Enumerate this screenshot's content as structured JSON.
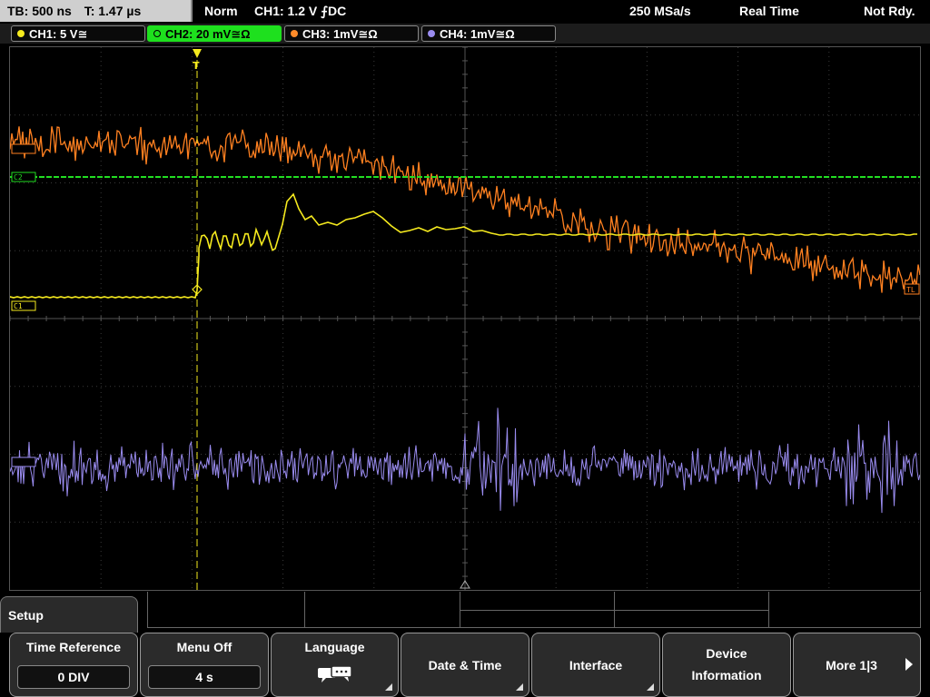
{
  "status": {
    "timebase": "TB: 500 ns",
    "trigger_time": "T: 1.47 µs",
    "mode": "Norm",
    "trigger_desc": "CH1: 1.2 V ⨍DC",
    "sample_rate": "250 MSa/s",
    "acq_mode": "Real Time",
    "state": "Not Rdy."
  },
  "channels": [
    {
      "label": "CH1: 5 V≅",
      "color": "#f5ea1e",
      "active": false
    },
    {
      "label": "CH2: 20 mV≅Ω",
      "color": "#22dd22",
      "active": true
    },
    {
      "label": "CH3: 1mV≅Ω",
      "color": "#ff8c2a",
      "active": false
    },
    {
      "label": "CH4: 1mV≅Ω",
      "color": "#9a8cf0",
      "active": false
    }
  ],
  "markers": {
    "ch1": "C1",
    "ch2": "C2",
    "trigger_level": "TL"
  },
  "menu": {
    "title": "Setup",
    "buttons": {
      "time_reference": {
        "label": "Time Reference",
        "value": "0 DIV"
      },
      "menu_off": {
        "label": "Menu Off",
        "value": "4 s"
      },
      "language": {
        "label": "Language"
      },
      "date_time": {
        "label": "Date & Time"
      },
      "interface": {
        "label": "Interface"
      },
      "device_info": {
        "label1": "Device",
        "label2": "Information"
      },
      "more": {
        "label": "More 1|3"
      }
    }
  }
}
